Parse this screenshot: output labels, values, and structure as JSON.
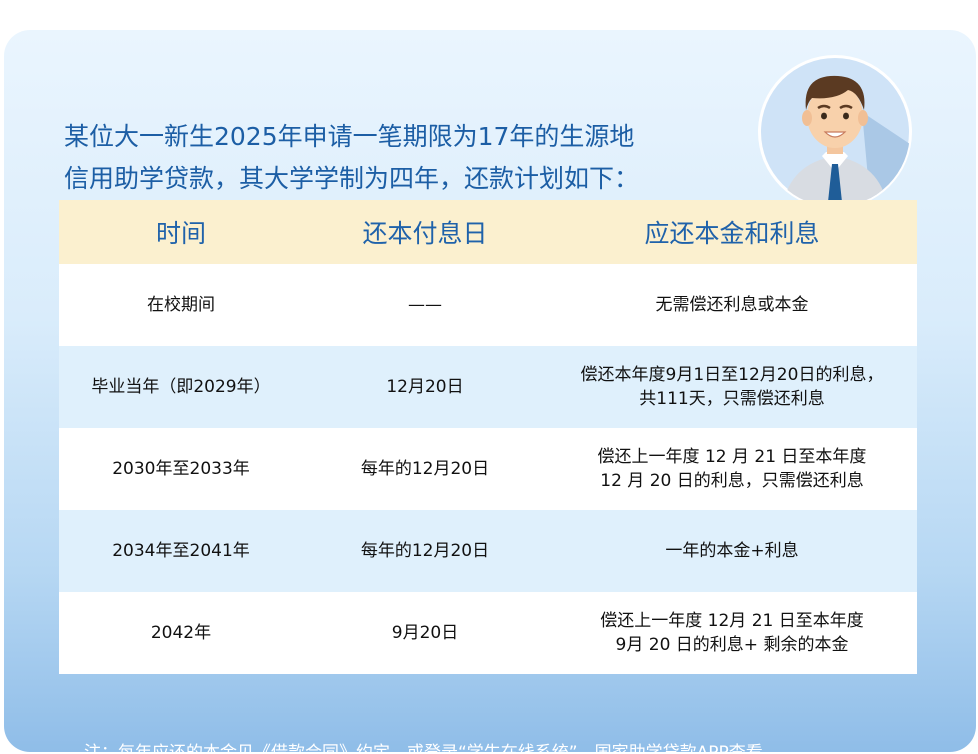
{
  "headline": {
    "line1": "某位大一新生2025年申请一笔期限为17年的生源地",
    "line2": "信用助学贷款，其大学学制为四年，还款计划如下："
  },
  "table": {
    "headers": [
      "时间",
      "还本付息日",
      "应还本金和利息"
    ],
    "rows": [
      {
        "period": "在校期间",
        "date": "——",
        "amount": [
          "无需偿还利息或本金"
        ]
      },
      {
        "period": "毕业当年（即2029年）",
        "date": "12月20日",
        "amount": [
          "偿还本年度9月1日至12月20日的利息，",
          "共111天，只需偿还利息"
        ]
      },
      {
        "period": "2030年至2033年",
        "date": "每年的12月20日",
        "amount": [
          "偿还上一年度 12 月 21 日至本年度",
          "12 月 20 日的利息，只需偿还利息"
        ]
      },
      {
        "period": "2034年至2041年",
        "date": "每年的12月20日",
        "amount": [
          "一年的本金+利息"
        ]
      },
      {
        "period": "2042年",
        "date": "9月20日",
        "amount": [
          "偿还上一年度 12月 21 日至本年度",
          "9月 20 日的利息+ 剩余的本金"
        ]
      }
    ]
  },
  "footnote": "注：每年应还的本金见《借款合同》约定，或登录“学生在线系统”、国家助学贷款APP查看。",
  "colors": {
    "headline": "#1c5ea5",
    "header_bg": "#fbf0cf",
    "header_text": "#1f62aa",
    "row_alt": "#dff0fc"
  }
}
